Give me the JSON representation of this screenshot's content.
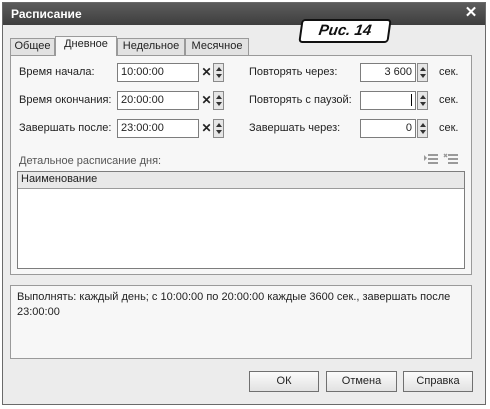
{
  "window": {
    "title": "Расписание",
    "close_glyph": "✕"
  },
  "figure_label": "Рис. 14",
  "tabs": [
    {
      "label": "Общее",
      "active": false
    },
    {
      "label": "Дневное",
      "active": true
    },
    {
      "label": "Недельное",
      "active": false
    },
    {
      "label": "Месячное",
      "active": false
    }
  ],
  "fields": {
    "start_time": {
      "label": "Время начала:",
      "value": "10:00:00"
    },
    "end_time": {
      "label": "Время окончания:",
      "value": "20:00:00"
    },
    "finish_after": {
      "label": "Завершать после:",
      "value": "23:00:00"
    },
    "repeat_every": {
      "label": "Повторять через:",
      "value": "3 600",
      "unit": "сек."
    },
    "repeat_pause": {
      "label": "Повторять с паузой:",
      "value": "",
      "unit": "сек."
    },
    "finish_in": {
      "label": "Завершать через:",
      "value": "0",
      "unit": "сек."
    }
  },
  "clear_glyph": "✕",
  "detail": {
    "label": "Детальное расписание дня:",
    "column": "Наименование",
    "rows": []
  },
  "summary": "Выполнять: каждый день; с 10:00:00 по 20:00:00 каждые 3600 сек., завершать после 23:00:00",
  "buttons": {
    "ok": "ОК",
    "cancel": "Отмена",
    "help": "Справка"
  },
  "icons": [
    "fill-list-icon",
    "clear-list-icon"
  ]
}
